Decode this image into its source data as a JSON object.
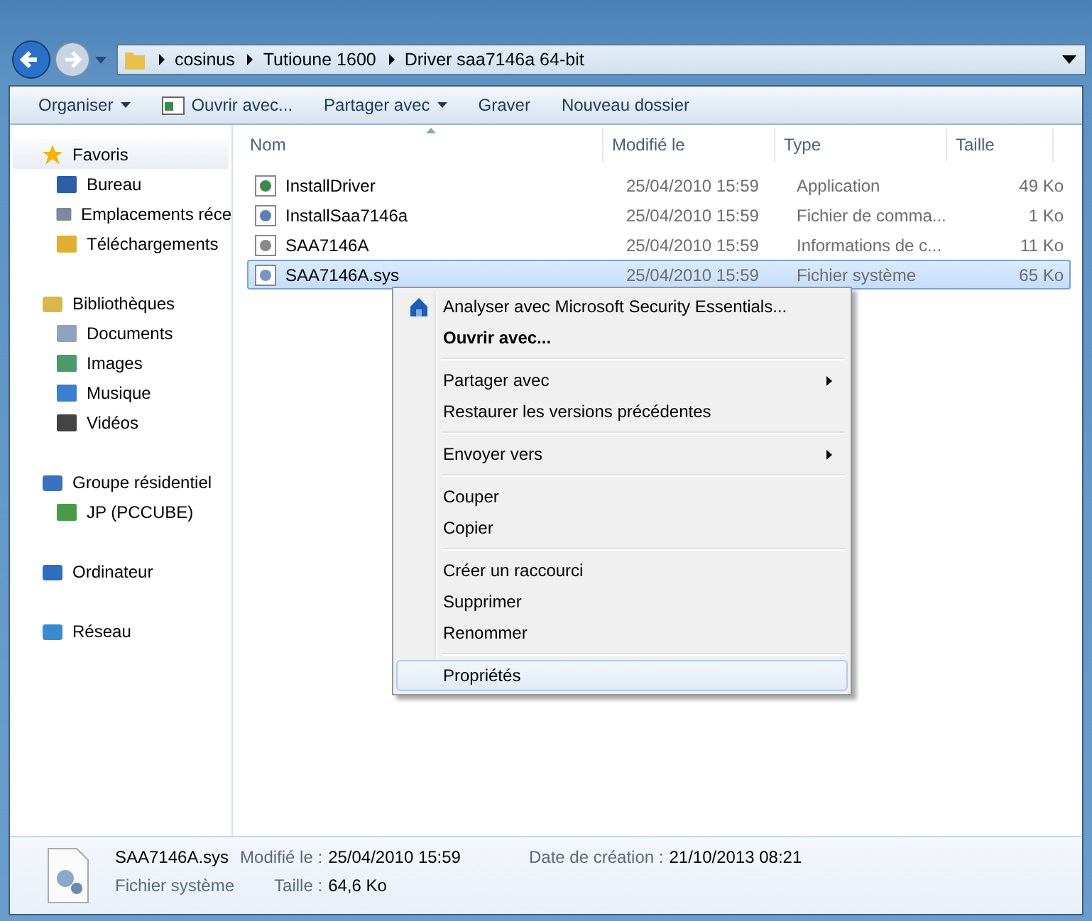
{
  "address_bar": {
    "crumbs": [
      "cosinus",
      "Tutioune 1600",
      "Driver saa7146a 64-bit"
    ]
  },
  "toolbar": [
    {
      "label": "Organiser",
      "dropdown": true,
      "icon": false
    },
    {
      "label": "Ouvrir avec...",
      "dropdown": false,
      "icon": true
    },
    {
      "label": "Partager avec",
      "dropdown": true,
      "icon": false
    },
    {
      "label": "Graver",
      "dropdown": false,
      "icon": false
    },
    {
      "label": "Nouveau dossier",
      "dropdown": false,
      "icon": false
    }
  ],
  "sidebar": {
    "groups": [
      {
        "label": "Favoris",
        "kind": "star",
        "selected": true,
        "children": [
          {
            "label": "Bureau",
            "kind": "desktop"
          },
          {
            "label": "Emplacements réce",
            "kind": "recent"
          },
          {
            "label": "Téléchargements",
            "kind": "download"
          }
        ]
      },
      {
        "label": "Bibliothèques",
        "kind": "library",
        "selected": false,
        "children": [
          {
            "label": "Documents",
            "kind": "doc"
          },
          {
            "label": "Images",
            "kind": "image"
          },
          {
            "label": "Musique",
            "kind": "music"
          },
          {
            "label": "Vidéos",
            "kind": "video"
          }
        ]
      },
      {
        "label": "Groupe résidentiel",
        "kind": "homegroup",
        "selected": false,
        "children": [
          {
            "label": "JP (PCCUBE)",
            "kind": "user"
          }
        ]
      },
      {
        "label": "Ordinateur",
        "kind": "computer",
        "selected": false
      },
      {
        "label": "Réseau",
        "kind": "network",
        "selected": false
      }
    ]
  },
  "table": {
    "columns": [
      "Nom",
      "Modifié le",
      "Type",
      "Taille"
    ],
    "rows": [
      {
        "name": "InstallDriver",
        "kind": "app",
        "modified": "25/04/2010 15:59",
        "type": "Application",
        "size": "49 Ko",
        "selected": false
      },
      {
        "name": "InstallSaa7146a",
        "kind": "cmd",
        "modified": "25/04/2010 15:59",
        "type": "Fichier de comma...",
        "size": "1 Ko",
        "selected": false
      },
      {
        "name": "SAA7146A",
        "kind": "inf",
        "modified": "25/04/2010 15:59",
        "type": "Informations de c...",
        "size": "11 Ko",
        "selected": false
      },
      {
        "name": "SAA7146A.sys",
        "kind": "sys",
        "modified": "25/04/2010 15:59",
        "type": "Fichier système",
        "size": "65 Ko",
        "selected": true
      }
    ]
  },
  "context_menu": {
    "groups": [
      [
        {
          "label": "Analyser avec Microsoft Security Essentials...",
          "bold": false,
          "submenu": false,
          "icon": true,
          "selected": false
        },
        {
          "label": "Ouvrir avec...",
          "bold": true,
          "submenu": false,
          "icon": false,
          "selected": false
        }
      ],
      [
        {
          "label": "Partager avec",
          "bold": false,
          "submenu": true,
          "icon": false,
          "selected": false
        },
        {
          "label": "Restaurer les versions précédentes",
          "bold": false,
          "submenu": false,
          "icon": false,
          "selected": false
        }
      ],
      [
        {
          "label": "Envoyer vers",
          "bold": false,
          "submenu": true,
          "icon": false,
          "selected": false
        }
      ],
      [
        {
          "label": "Couper",
          "bold": false,
          "submenu": false,
          "icon": false,
          "selected": false
        },
        {
          "label": "Copier",
          "bold": false,
          "submenu": false,
          "icon": false,
          "selected": false
        }
      ],
      [
        {
          "label": "Créer un raccourci",
          "bold": false,
          "submenu": false,
          "icon": false,
          "selected": false
        },
        {
          "label": "Supprimer",
          "bold": false,
          "submenu": false,
          "icon": false,
          "selected": false
        },
        {
          "label": "Renommer",
          "bold": false,
          "submenu": false,
          "icon": false,
          "selected": false
        }
      ],
      [
        {
          "label": "Propriétés",
          "bold": false,
          "submenu": false,
          "icon": false,
          "selected": true
        }
      ]
    ]
  },
  "details_pane": {
    "name": "SAA7146A.sys",
    "type": "Fichier système",
    "fields": [
      {
        "label": "Modifié le :",
        "value": "25/04/2010 15:59"
      },
      {
        "label": "Date de création :",
        "value": "21/10/2013 08:21"
      },
      {
        "label": "Taille :",
        "value": "64,6 Ko"
      }
    ]
  }
}
